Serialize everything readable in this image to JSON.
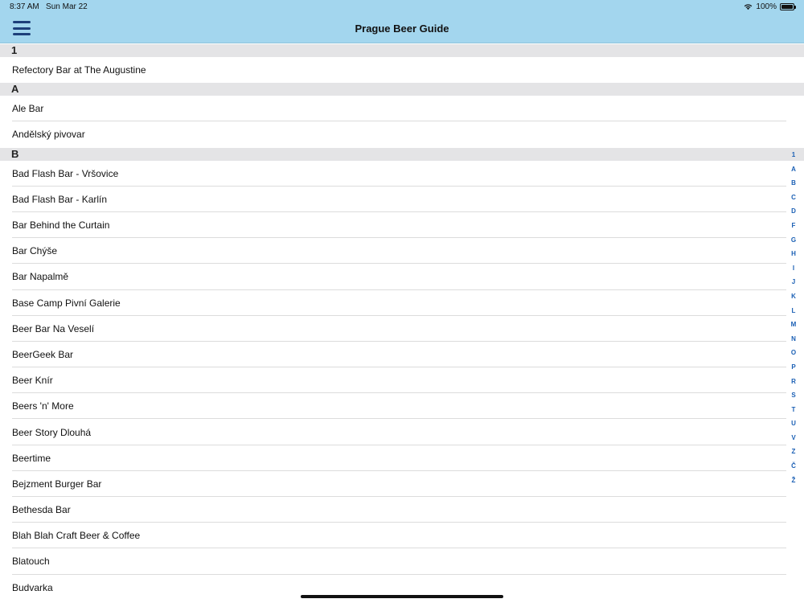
{
  "status": {
    "time": "8:37 AM",
    "date": "Sun Mar 22",
    "battery": "100%",
    "battery_level": 1.0
  },
  "header": {
    "title": "Prague Beer Guide",
    "menu_icon": "hamburger-menu-icon"
  },
  "sections": [
    {
      "title": "1",
      "items": [
        "Refectory Bar at The Augustine"
      ]
    },
    {
      "title": "A",
      "items": [
        "Ale Bar",
        "Andělský pivovar"
      ]
    },
    {
      "title": "B",
      "items": [
        "Bad Flash Bar - Vršovice",
        "Bad Flash Bar - Karlín",
        "Bar Behind the Curtain",
        "Bar Chýše",
        "Bar Napalmě",
        "Base Camp Pivní Galerie",
        "Beer Bar Na Veselí",
        "BeerGeek Bar",
        "Beer Knír",
        "Beers 'n' More",
        "Beer Story Dlouhá",
        "Beertime",
        "Bejzment Burger Bar",
        "Bethesda Bar",
        "Blah Blah Craft Beer & Coffee",
        "Blatouch",
        "Budvarka"
      ]
    }
  ],
  "index": [
    "1",
    "A",
    "B",
    "C",
    "D",
    "F",
    "G",
    "H",
    "I",
    "J",
    "K",
    "L",
    "M",
    "N",
    "O",
    "P",
    "R",
    "S",
    "T",
    "U",
    "V",
    "Z",
    "Č",
    "Ž"
  ],
  "colors": {
    "header_bg": "#a3d6ee",
    "section_bg": "#e4e4e6",
    "index_accent": "#1a5fb4",
    "menu_icon": "#1d3f7a"
  }
}
